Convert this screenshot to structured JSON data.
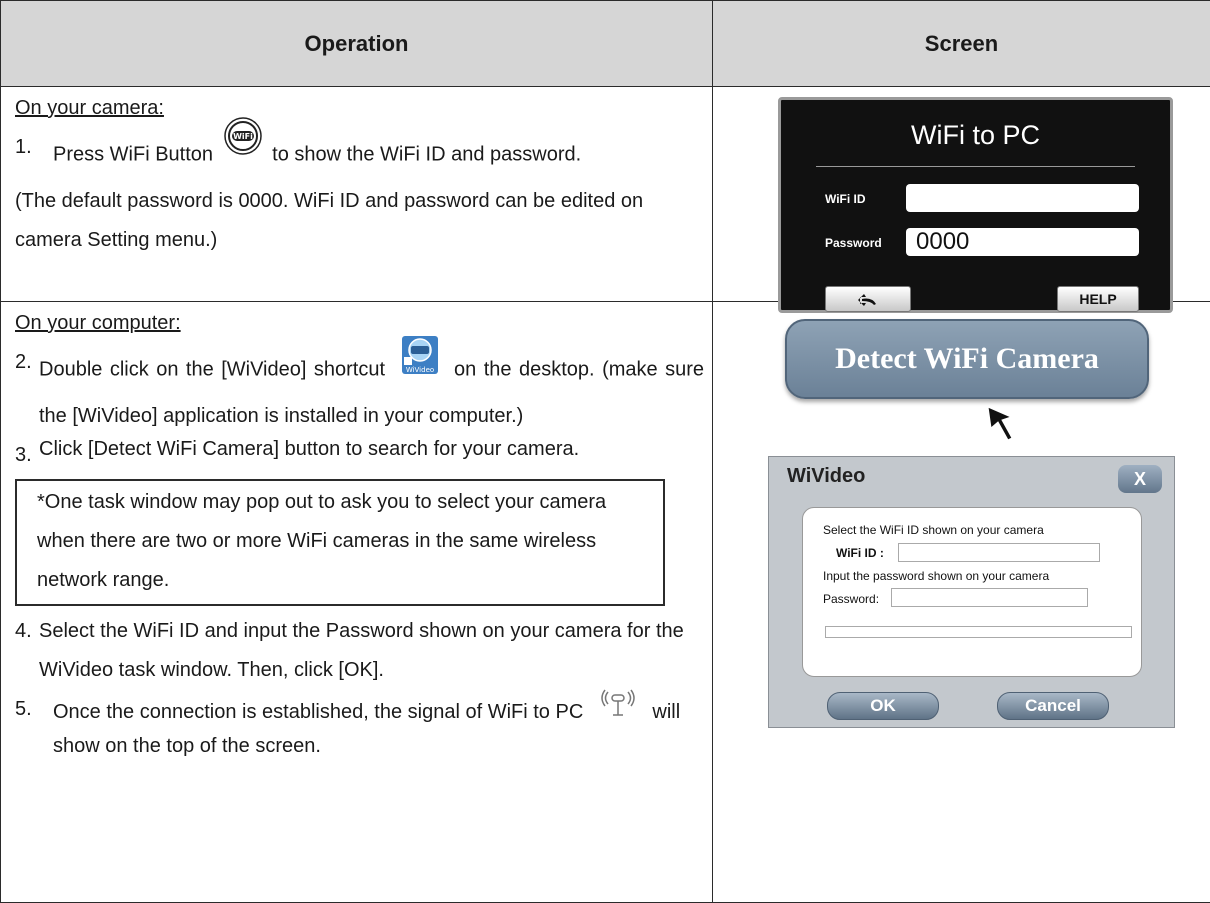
{
  "headers": {
    "operation": "Operation",
    "screen": "Screen"
  },
  "row1": {
    "heading": "On your camera:",
    "step1_num": "1.",
    "step1_before": "Press WiFi Button",
    "step1_after": "to show the WiFi ID and password.",
    "note": "(The default password is 0000. WiFi ID and password can be edited on camera Setting menu.)"
  },
  "camera_screen": {
    "title": "WiFi to PC",
    "wifi_id_label": "WiFi ID",
    "wifi_id_value": "",
    "password_label": "Password",
    "password_value": "0000",
    "back_icon": "back-arrow-icon",
    "help_label": "HELP"
  },
  "row2": {
    "heading": "On your computer:",
    "step2_num": "2.",
    "step2_before": "Double click on the [WiVideo] shortcut",
    "step2_after": "on the desktop. (make sure the [WiVideo] application is installed in your computer.)",
    "step3_num": "3.",
    "step3": "Click [Detect WiFi Camera] button to search for your camera.",
    "note": "*One task window may pop out to ask you to select your camera when there are two or more WiFi cameras in the same wireless network range.",
    "step4_num": "4.",
    "step4": "Select the WiFi ID and input the Password shown on your camera for the WiVideo task window. Then, click [OK].",
    "step5_num": "5.",
    "step5_before": "Once the connection is established, the signal of WiFi to PC",
    "step5_after": "will show on the top of the screen."
  },
  "detect_button": {
    "label": "Detect WiFi Camera"
  },
  "shortcut_icon": {
    "caption": "WiVideo"
  },
  "wivideo_dialog": {
    "title": "WiVideo",
    "close_label": "X",
    "select_text": "Select the WiFi ID shown on your camera",
    "wifi_id_label": "WiFi ID  :",
    "input_text": "Input the password shown on your camera",
    "password_label": "Password:",
    "ok_label": "OK",
    "cancel_label": "Cancel"
  }
}
